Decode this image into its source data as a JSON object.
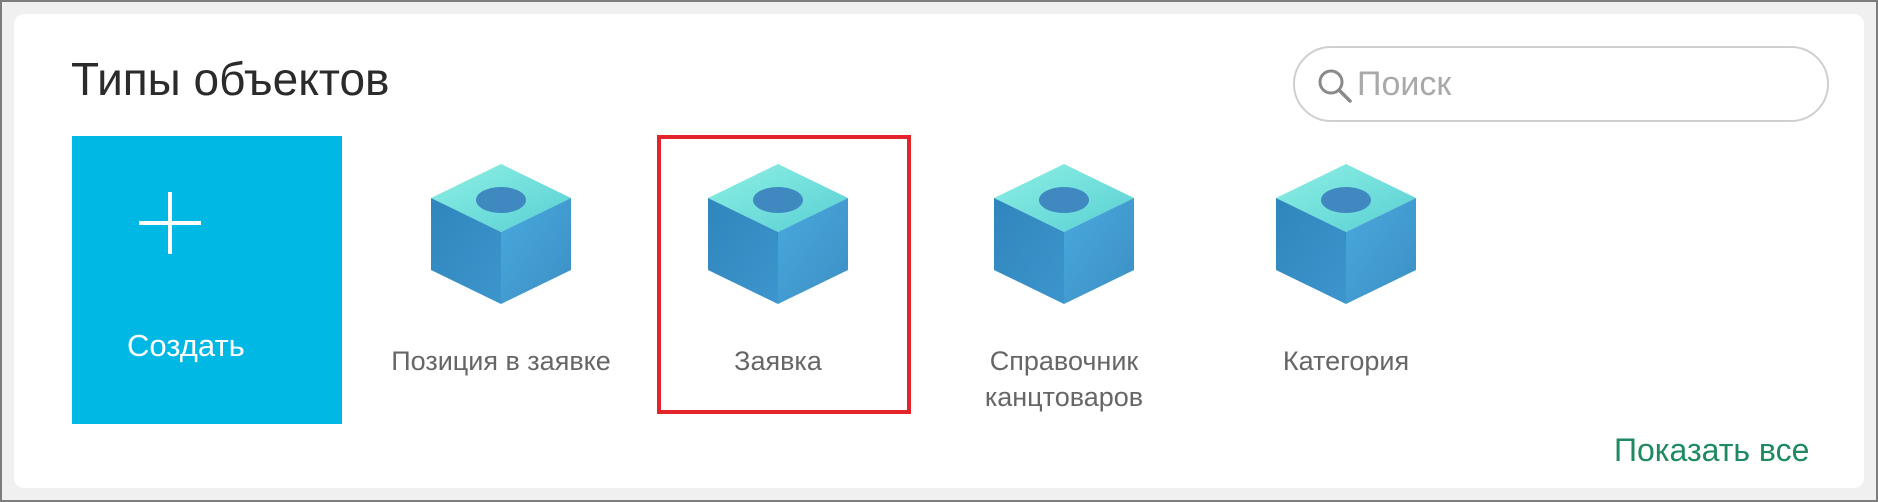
{
  "panel": {
    "title": "Типы объектов",
    "show_all_label": "Показать все"
  },
  "search": {
    "placeholder": "Поиск",
    "value": "",
    "icon": "search-icon"
  },
  "create_tile": {
    "label": "Создать",
    "icon": "plus-icon",
    "color": "#00b8e4"
  },
  "types": [
    {
      "label": "Позиция в заявке",
      "icon": "cube-icon"
    },
    {
      "label": "Заявка",
      "icon": "cube-icon",
      "highlighted": true
    },
    {
      "label": "Справочник канцтоваров",
      "icon": "cube-icon"
    },
    {
      "label": "Категория",
      "icon": "cube-icon"
    }
  ],
  "colors": {
    "create_tile_bg": "#00b8e4",
    "highlight_border": "#e3242b",
    "link": "#1f8a61",
    "cube_top": "#7fe0dc",
    "cube_side": "#3f93c8"
  }
}
